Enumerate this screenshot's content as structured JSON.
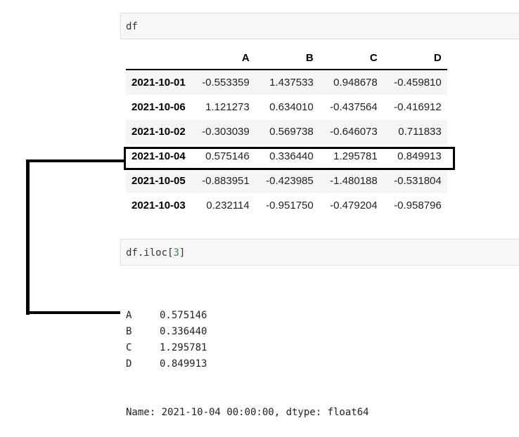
{
  "cell1": {
    "code": "df"
  },
  "table": {
    "columns": [
      "A",
      "B",
      "C",
      "D"
    ],
    "rows": [
      {
        "index": "2021-10-01",
        "values": [
          "-0.553359",
          "1.437533",
          "0.948678",
          "-0.459810"
        ]
      },
      {
        "index": "2021-10-06",
        "values": [
          "1.121273",
          "0.634010",
          "-0.437564",
          "-0.416912"
        ]
      },
      {
        "index": "2021-10-02",
        "values": [
          "-0.303039",
          "0.569738",
          "-0.646073",
          "0.711833"
        ]
      },
      {
        "index": "2021-10-04",
        "values": [
          "0.575146",
          "0.336440",
          "1.295781",
          "0.849913"
        ]
      },
      {
        "index": "2021-10-05",
        "values": [
          "-0.883951",
          "-0.423985",
          "-1.480188",
          "-0.531804"
        ]
      },
      {
        "index": "2021-10-03",
        "values": [
          "0.232114",
          "-0.951750",
          "-0.479204",
          "-0.958796"
        ]
      }
    ],
    "highlighted_row": "2021-10-04"
  },
  "cell2": {
    "code_prefix": "df.iloc[",
    "code_arg": "3",
    "code_suffix": "]"
  },
  "output": {
    "items": [
      {
        "key": "A",
        "value": "0.575146"
      },
      {
        "key": "B",
        "value": "0.336440"
      },
      {
        "key": "C",
        "value": "1.295781"
      },
      {
        "key": "D",
        "value": "0.849913"
      }
    ],
    "footer": "Name: 2021-10-04 00:00:00, dtype: float64"
  }
}
